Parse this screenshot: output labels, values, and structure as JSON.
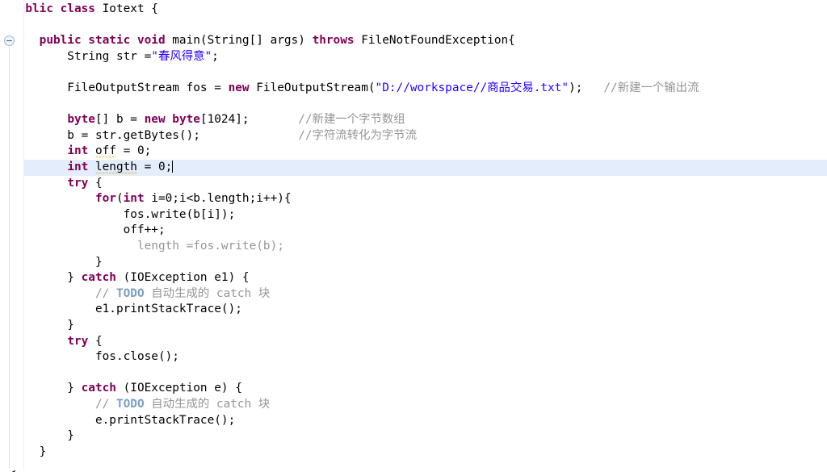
{
  "editor": {
    "kind": "java-source-editor",
    "theme": {
      "background": "#ffffff",
      "keyword": "#7f0055",
      "string": "#2a00ff",
      "comment": "#969696",
      "todo_tag": "#7a9ec2",
      "plain_text": "#000000",
      "current_line_highlight": "#e4edfb",
      "warning_squiggle": "#d8b43c",
      "gutter_separator": "#eceff5"
    },
    "caret_line_index": 9,
    "gutter": {
      "fold_markers": [
        {
          "label": "collapse-method-fold",
          "glyph": "⊖",
          "line_index": 2
        }
      ]
    }
  },
  "code": {
    "lines": [
      {
        "i": 0,
        "text": "public class Iotext {",
        "tokens": [
          {
            "t": "public class",
            "c": "kw"
          },
          {
            "t": " Iotext {",
            "c": "plain"
          }
        ]
      },
      {
        "i": 1,
        "text": "",
        "tokens": []
      },
      {
        "i": 2,
        "text": "    public static void main(String[] args) throws FileNotFoundException{",
        "tokens": [
          {
            "t": "    ",
            "c": "plain"
          },
          {
            "t": "public static void",
            "c": "kw"
          },
          {
            "t": " main(String[] args) ",
            "c": "plain"
          },
          {
            "t": "throws",
            "c": "kw"
          },
          {
            "t": " FileNotFoundException{",
            "c": "plain"
          }
        ]
      },
      {
        "i": 3,
        "text": "        String str =\"春风得意\";",
        "tokens": [
          {
            "t": "        String str =",
            "c": "plain"
          },
          {
            "t": "\"春风得意\"",
            "c": "str"
          },
          {
            "t": ";",
            "c": "plain"
          }
        ]
      },
      {
        "i": 4,
        "text": "",
        "tokens": []
      },
      {
        "i": 5,
        "text": "        FileOutputStream fos = new FileOutputStream(\"D://workspace//商品交易.txt\");   //新建一个输出流",
        "tokens": [
          {
            "t": "        FileOutputStream fos = ",
            "c": "plain"
          },
          {
            "t": "new",
            "c": "kw"
          },
          {
            "t": " FileOutputStream(",
            "c": "plain"
          },
          {
            "t": "\"D://workspace//商品交易.txt\"",
            "c": "str"
          },
          {
            "t": ");   ",
            "c": "plain"
          },
          {
            "t": "//新建一个输出流",
            "c": "cmt"
          }
        ]
      },
      {
        "i": 6,
        "text": "",
        "tokens": []
      },
      {
        "i": 7,
        "text": "        byte[] b = new byte[1024];       //新建一个字节数组",
        "tokens": [
          {
            "t": "        ",
            "c": "plain"
          },
          {
            "t": "byte",
            "c": "kw"
          },
          {
            "t": "[] b = ",
            "c": "plain"
          },
          {
            "t": "new byte",
            "c": "kw"
          },
          {
            "t": "[1024];       ",
            "c": "plain"
          },
          {
            "t": "//新建一个字节数组",
            "c": "cmt"
          }
        ]
      },
      {
        "i": 8,
        "text": "        b = str.getBytes();              //字符流转化为字节流",
        "tokens": [
          {
            "t": "        b = str.getBytes();              ",
            "c": "plain"
          },
          {
            "t": "//字符流转化为字节流",
            "c": "cmt"
          }
        ]
      },
      {
        "i": 9,
        "text": "        int off = 0;",
        "tokens": [
          {
            "t": "        ",
            "c": "plain"
          },
          {
            "t": "int",
            "c": "kw"
          },
          {
            "t": " ",
            "c": "plain"
          },
          {
            "t": "off",
            "c": "plain warn"
          },
          {
            "t": " = 0;",
            "c": "plain"
          }
        ]
      },
      {
        "i": 10,
        "text": "        int length = 0;",
        "current": true,
        "caret": true,
        "tokens": [
          {
            "t": "        ",
            "c": "plain"
          },
          {
            "t": "int",
            "c": "kw"
          },
          {
            "t": " ",
            "c": "plain"
          },
          {
            "t": "length",
            "c": "plain warn"
          },
          {
            "t": " = 0;",
            "c": "plain"
          }
        ]
      },
      {
        "i": 11,
        "text": "        try {",
        "tokens": [
          {
            "t": "        ",
            "c": "plain"
          },
          {
            "t": "try",
            "c": "kw"
          },
          {
            "t": " {",
            "c": "plain"
          }
        ]
      },
      {
        "i": 12,
        "text": "            for(int i=0;i<b.length;i++){",
        "tokens": [
          {
            "t": "            ",
            "c": "plain"
          },
          {
            "t": "for",
            "c": "kw"
          },
          {
            "t": "(",
            "c": "plain"
          },
          {
            "t": "int",
            "c": "kw"
          },
          {
            "t": " i=0;i<b.length;i++){",
            "c": "plain"
          }
        ]
      },
      {
        "i": 13,
        "text": "                fos.write(b[i]);",
        "tokens": [
          {
            "t": "                fos.write(b[i]);",
            "c": "plain"
          }
        ]
      },
      {
        "i": 14,
        "text": "                off++;",
        "tokens": [
          {
            "t": "                off++;",
            "c": "plain"
          }
        ]
      },
      {
        "i": 15,
        "text": "//              length =fos.write(b);",
        "gutter_comment": "//",
        "tokens": [
          {
            "t": "                length =fos.write(b);",
            "c": "cmt"
          }
        ]
      },
      {
        "i": 16,
        "text": "            }",
        "tokens": [
          {
            "t": "            }",
            "c": "plain"
          }
        ]
      },
      {
        "i": 17,
        "text": "        } catch (IOException e1) {",
        "tokens": [
          {
            "t": "        } ",
            "c": "plain"
          },
          {
            "t": "catch",
            "c": "kw"
          },
          {
            "t": " (IOException e1) {",
            "c": "plain"
          }
        ]
      },
      {
        "i": 18,
        "text": "            // TODO 自动生成的 catch 块",
        "tokens": [
          {
            "t": "            ",
            "c": "plain"
          },
          {
            "t": "// ",
            "c": "cmt"
          },
          {
            "t": "TODO",
            "c": "todo"
          },
          {
            "t": " 自动生成的 catch 块",
            "c": "cmt"
          }
        ]
      },
      {
        "i": 19,
        "text": "            e1.printStackTrace();",
        "tokens": [
          {
            "t": "            e1.printStackTrace();",
            "c": "plain"
          }
        ]
      },
      {
        "i": 20,
        "text": "        }",
        "tokens": [
          {
            "t": "        }",
            "c": "plain"
          }
        ]
      },
      {
        "i": 21,
        "text": "        try {",
        "tokens": [
          {
            "t": "        ",
            "c": "plain"
          },
          {
            "t": "try",
            "c": "kw"
          },
          {
            "t": " {",
            "c": "plain"
          }
        ]
      },
      {
        "i": 22,
        "text": "            fos.close();",
        "tokens": [
          {
            "t": "            fos.close();",
            "c": "plain"
          }
        ]
      },
      {
        "i": 23,
        "text": "",
        "tokens": []
      },
      {
        "i": 24,
        "text": "        } catch (IOException e) {",
        "tokens": [
          {
            "t": "        } ",
            "c": "plain"
          },
          {
            "t": "catch",
            "c": "kw"
          },
          {
            "t": " (IOException e) {",
            "c": "plain"
          }
        ]
      },
      {
        "i": 25,
        "text": "            // TODO 自动生成的 catch 块",
        "tokens": [
          {
            "t": "            ",
            "c": "plain"
          },
          {
            "t": "// ",
            "c": "cmt"
          },
          {
            "t": "TODO",
            "c": "todo"
          },
          {
            "t": " 自动生成的 catch 块",
            "c": "cmt"
          }
        ]
      },
      {
        "i": 26,
        "text": "            e.printStackTrace();",
        "tokens": [
          {
            "t": "            e.printStackTrace();",
            "c": "plain"
          }
        ]
      },
      {
        "i": 27,
        "text": "        }",
        "tokens": [
          {
            "t": "        }",
            "c": "plain"
          }
        ]
      },
      {
        "i": 28,
        "text": "    }",
        "tokens": [
          {
            "t": "    }",
            "c": "plain"
          }
        ]
      },
      {
        "i": 29,
        "text": "}",
        "tokens": [
          {
            "t": "}",
            "c": "plain"
          }
        ]
      }
    ]
  }
}
